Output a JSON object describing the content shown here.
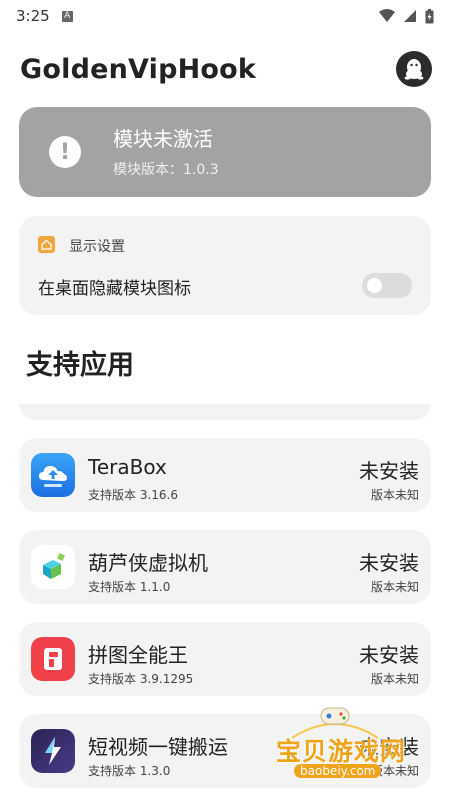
{
  "status_bar": {
    "time": "3:25",
    "notif_icon_letter": "A"
  },
  "header": {
    "title": "GoldenVipHook",
    "qq_icon": "qq-penguin-icon"
  },
  "module_status": {
    "title": "模块未激活",
    "version": "模块版本：1.0.3",
    "icon": "exclamation-icon",
    "color": "#a3a3a3"
  },
  "display_settings": {
    "title": "显示设置",
    "icon": "home-icon",
    "icon_color": "#f2a640",
    "hide_icon_label": "在桌面隐藏模块图标",
    "hide_icon_enabled": false
  },
  "supported_apps": {
    "section_title": "支持应用",
    "items": [
      {
        "name": "TeraBox",
        "version": "支持版本 3.16.6",
        "status": "未安装",
        "status_sub": "版本未知",
        "icon": "terabox-cloud-icon",
        "icon_color": "#2c8ef0"
      },
      {
        "name": "葫芦侠虚拟机",
        "version": "支持版本 1.1.0",
        "status": "未安装",
        "status_sub": "版本未知",
        "icon": "cube-icon",
        "icon_color": "#29b6d8"
      },
      {
        "name": "拼图全能王",
        "version": "支持版本 3.9.1295",
        "status": "未安装",
        "status_sub": "版本未知",
        "icon": "puzzle-icon",
        "icon_color": "#f0404a"
      },
      {
        "name": "短视频一键搬运",
        "version": "支持版本 1.3.0",
        "status": "未安装",
        "status_sub": "版本未知",
        "icon": "bolt-icon",
        "icon_color": "#3a2f6a"
      }
    ]
  },
  "watermark": {
    "text": "宝贝游戏网",
    "url": "baobeiy.com"
  }
}
